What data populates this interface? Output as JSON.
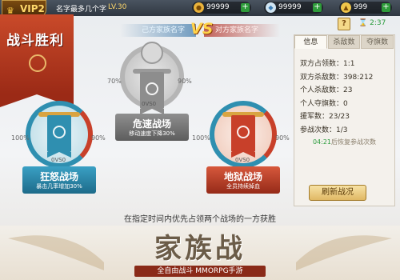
{
  "topbar": {
    "vip": "VIP2",
    "player_name": "名字最多几个字",
    "level": "LV.30",
    "coins": "99999",
    "gems": "99999",
    "gold": "999",
    "help": "?",
    "timer": "2:37"
  },
  "banner": {
    "title": "战斗胜利"
  },
  "versus": {
    "our_clan": "己方家族名字",
    "vs": "VS",
    "enemy_clan": "对方家族名字"
  },
  "fields": [
    {
      "name": "危速战场",
      "desc": "移动速度下降30%",
      "left_pct": "70%",
      "right_pct": "90%",
      "score": "0VS0",
      "status": "neutral"
    },
    {
      "name": "狂怒战场",
      "desc": "暴击几率增加30%",
      "left_pct": "100%",
      "right_pct": "90%",
      "score": "0VS0",
      "status": "ours"
    },
    {
      "name": "地狱战场",
      "desc": "全员持续掉血",
      "left_pct": "100%",
      "right_pct": "90%",
      "score": "0VS0",
      "status": "enemy"
    }
  ],
  "panel": {
    "tabs": [
      "信息",
      "杀敌数",
      "夺旗数"
    ],
    "stats": [
      {
        "label": "双方占领数：",
        "value": "1:1"
      },
      {
        "label": "双方杀敌数：",
        "value": "398:212"
      },
      {
        "label": "个人杀敌数：",
        "value": "23"
      },
      {
        "label": "个人夺旗数：",
        "value": "0"
      },
      {
        "label": "援军数：",
        "value": "23/23"
      },
      {
        "label": "参战次数：",
        "value": "1/3"
      }
    ],
    "recover_time": "04:21",
    "recover_text": "后恢复参战次数",
    "refresh": "刷新战况"
  },
  "hint": "在指定时间内优先占领两个战场的一方获胜",
  "promo": {
    "title": "家族战",
    "subtitle": "全自由战斗 MMORPG手游"
  },
  "colors": {
    "ours": "#2f8fb0",
    "enemy": "#c8402a",
    "neutral": "#8a8a8a",
    "gold": "#d9a441"
  }
}
